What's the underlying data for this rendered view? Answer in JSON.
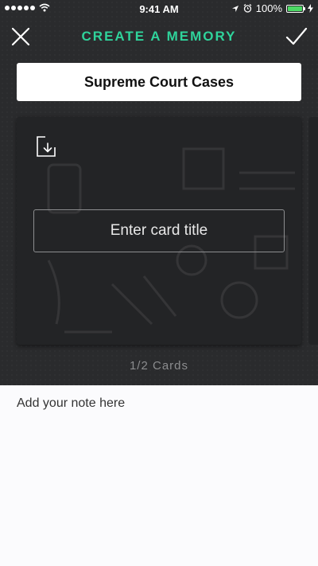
{
  "status_bar": {
    "time": "9:41 AM",
    "battery": "100%",
    "battery_level": 1.0,
    "icons": [
      "signal-dots",
      "wifi-icon",
      "location-icon",
      "alarm-icon",
      "battery-icon",
      "charging-icon"
    ]
  },
  "navbar": {
    "title": "CREATE A MEMORY",
    "title_color": "#2fd39b",
    "close_icon": "close-icon",
    "confirm_icon": "checkmark-icon"
  },
  "deck": {
    "title": "Supreme Court Cases"
  },
  "card": {
    "import_icon": "import-icon",
    "title_placeholder": "Enter card title",
    "title_value": ""
  },
  "card_count": "1/2 Cards",
  "note": {
    "placeholder": "Add your note here",
    "value": ""
  }
}
